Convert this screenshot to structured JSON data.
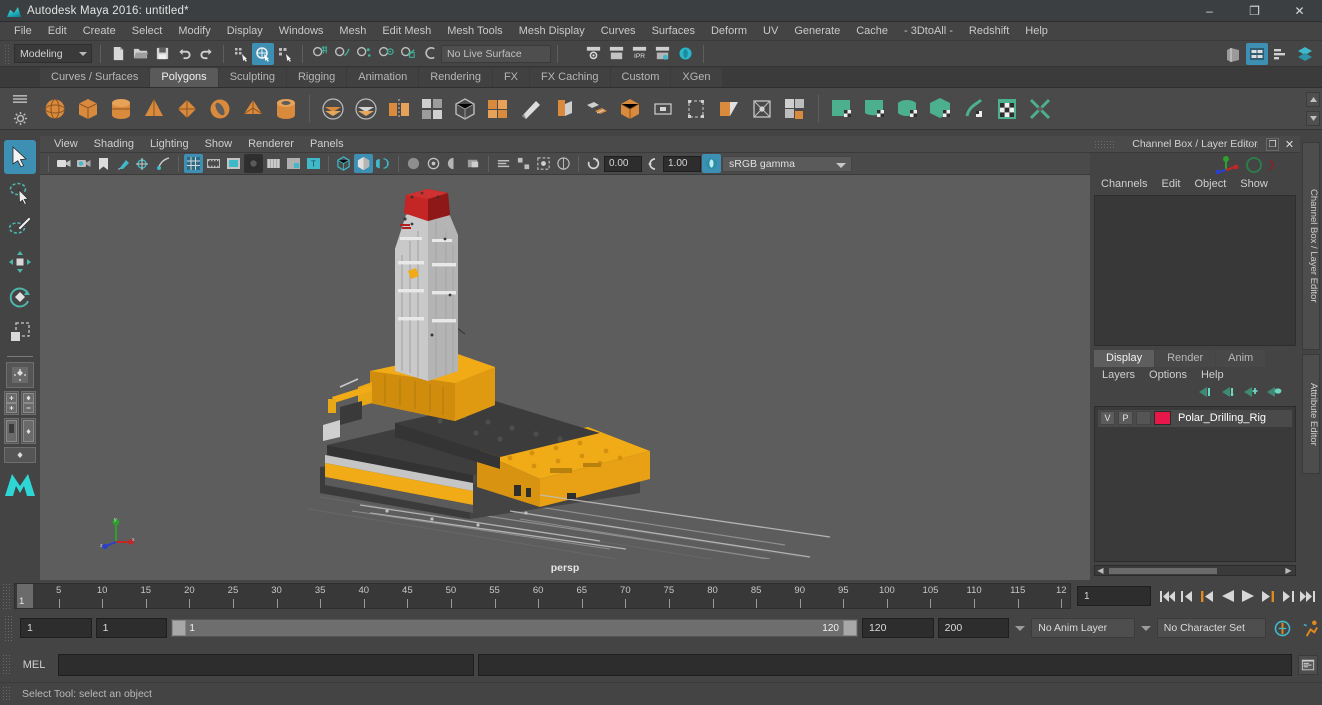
{
  "window": {
    "title": "Autodesk Maya 2016: untitled*",
    "icon": "maya-logo-icon",
    "minimize": "–",
    "maximize": "❐",
    "close": "✕"
  },
  "menubar": {
    "items": [
      {
        "label": "File"
      },
      {
        "label": "Edit"
      },
      {
        "label": "Create"
      },
      {
        "label": "Select"
      },
      {
        "label": "Modify"
      },
      {
        "label": "Display"
      },
      {
        "label": "Windows"
      },
      {
        "label": "Mesh"
      },
      {
        "label": "Edit Mesh"
      },
      {
        "label": "Mesh Tools"
      },
      {
        "label": "Mesh Display"
      },
      {
        "label": "Curves"
      },
      {
        "label": "Surfaces"
      },
      {
        "label": "Deform"
      },
      {
        "label": "UV"
      },
      {
        "label": "Generate"
      },
      {
        "label": "Cache"
      },
      {
        "label": "- 3DtoAll -"
      },
      {
        "label": "Redshift"
      },
      {
        "label": "Help"
      }
    ]
  },
  "statusline": {
    "menuset": "Modeling",
    "live_surface": "No Live Surface",
    "file_icons": [
      "new-scene-icon",
      "open-scene-icon",
      "save-scene-icon",
      "undo-icon",
      "redo-icon"
    ],
    "select_mode_icons": [
      "select-by-hierarchy-icon",
      "select-by-object-type-icon",
      "select-by-component-type-icon"
    ],
    "snap_icons": [
      "snap-to-grid-icon",
      "snap-to-curve-icon",
      "snap-to-point-icon",
      "snap-to-projected-center-icon",
      "snap-to-view-plane-icon",
      "make-live-icon"
    ],
    "render_icons": [
      "render-current-frame-icon",
      "render-sequence-icon",
      "ipr-render-icon",
      "render-settings-icon",
      "hypershade-icon"
    ],
    "panel_toggle_icons": [
      "toggle-modeling-panel-icon",
      "toggle-attribute-editor-icon",
      "toggle-tool-settings-icon",
      "toggle-channel-box-icon"
    ]
  },
  "shelf": {
    "tabs": [
      {
        "label": "Curves / Surfaces",
        "active": false
      },
      {
        "label": "Polygons",
        "active": true
      },
      {
        "label": "Sculpting",
        "active": false
      },
      {
        "label": "Rigging",
        "active": false
      },
      {
        "label": "Animation",
        "active": false
      },
      {
        "label": "Rendering",
        "active": false
      },
      {
        "label": "FX",
        "active": false
      },
      {
        "label": "FX Caching",
        "active": false
      },
      {
        "label": "Custom",
        "active": false
      },
      {
        "label": "XGen",
        "active": false
      }
    ],
    "icons": [
      "polygon-sphere-icon",
      "polygon-cube-icon",
      "polygon-cylinder-icon",
      "polygon-cone-icon",
      "polygon-plane-icon",
      "polygon-torus-icon",
      "polygon-pyramid-icon",
      "polygon-pipe-icon",
      "sep",
      "boolean-union-icon",
      "boolean-difference-icon",
      "mirror-geometry-icon",
      "combine-icon",
      "smooth-icon",
      "sep2",
      "multi-cut-icon",
      "extrude-icon",
      "bevel-icon",
      "bridge-icon",
      "append-polygon-icon",
      "wedge-face-icon",
      "poke-face-icon",
      "chamfer-vertex-icon",
      "connect-icon",
      "detach-icon",
      "sep3",
      "uv-planar-icon",
      "uv-cylindrical-icon",
      "uv-spherical-icon",
      "uv-automatic-icon",
      "uv-unfold-icon",
      "uv-editor-icon",
      "uv-cut-sew-icon"
    ]
  },
  "toolbox": {
    "tools": [
      {
        "name": "select-tool",
        "active": true
      },
      {
        "name": "lasso-select-tool",
        "active": false
      },
      {
        "name": "paint-select-tool",
        "active": false
      },
      {
        "name": "move-tool",
        "active": false
      },
      {
        "name": "rotate-tool",
        "active": false
      },
      {
        "name": "scale-tool",
        "active": false
      }
    ],
    "layouts": [
      "single-perspective-layout",
      "four-view-layout",
      "persp-outliner-layout",
      "hypershade-layout",
      "render-view-layout"
    ]
  },
  "viewport": {
    "menus": [
      "View",
      "Shading",
      "Lighting",
      "Show",
      "Renderer",
      "Panels"
    ],
    "toolbar_icons": [
      "select-camera-icon",
      "camera-attributes-icon",
      "bookmark-icon",
      "image-plane-icon",
      "two-d-pan-zoom-icon",
      "grease-pencil-icon",
      "grid-toggle-icon",
      "film-gate-icon",
      "resolution-gate-icon",
      "gate-mask-icon",
      "film-origin-icon",
      "exposure-icon",
      "texture-icon",
      "wireframe-icon",
      "smooth-shade-icon",
      "shaded-wireframe-icon",
      "textured-icon",
      "use-all-lights-icon",
      "shadows-icon",
      "screen-space-ao-icon",
      "motion-blur-icon",
      "multisample-icon",
      "isolate-select-icon",
      "xray-icon"
    ],
    "exposure_value": "0.00",
    "gamma_value": "1.00",
    "color_space": "sRGB gamma",
    "camera_label": "persp",
    "axis_labels": {
      "x": "x",
      "y": "y",
      "z": "z"
    }
  },
  "channel_box": {
    "panel_title": "Channel Box / Layer Editor",
    "menus": [
      "Channels",
      "Edit",
      "Object",
      "Show"
    ],
    "side_tabs": [
      "Channel Box / Layer Editor",
      "Attribute Editor"
    ],
    "undock_btn": "❐",
    "close_btn": "✕"
  },
  "layer_editor": {
    "tabs": [
      {
        "label": "Display",
        "active": true
      },
      {
        "label": "Render",
        "active": false
      },
      {
        "label": "Anim",
        "active": false
      }
    ],
    "menus": [
      "Layers",
      "Options",
      "Help"
    ],
    "buttons": [
      "move-layer-up-icon",
      "move-layer-down-icon",
      "new-layer-icon",
      "new-layer-from-selected-icon"
    ],
    "layers": [
      {
        "visibility": "V",
        "playback": "P",
        "state": "",
        "color": "#e8174a",
        "name": "Polar_Drilling_Rig"
      }
    ]
  },
  "timeline": {
    "current_frame": "1",
    "frame_field": "1",
    "ticks": [
      {
        "label": "5",
        "frame": 5
      },
      {
        "label": "10",
        "frame": 10
      },
      {
        "label": "15",
        "frame": 15
      },
      {
        "label": "20",
        "frame": 20
      },
      {
        "label": "25",
        "frame": 25
      },
      {
        "label": "30",
        "frame": 30
      },
      {
        "label": "35",
        "frame": 35
      },
      {
        "label": "40",
        "frame": 40
      },
      {
        "label": "45",
        "frame": 45
      },
      {
        "label": "50",
        "frame": 50
      },
      {
        "label": "55",
        "frame": 55
      },
      {
        "label": "60",
        "frame": 60
      },
      {
        "label": "65",
        "frame": 65
      },
      {
        "label": "70",
        "frame": 70
      },
      {
        "label": "75",
        "frame": 75
      },
      {
        "label": "80",
        "frame": 80
      },
      {
        "label": "85",
        "frame": 85
      },
      {
        "label": "90",
        "frame": 90
      },
      {
        "label": "95",
        "frame": 95
      },
      {
        "label": "100",
        "frame": 100
      },
      {
        "label": "105",
        "frame": 105
      },
      {
        "label": "110",
        "frame": 110
      },
      {
        "label": "115",
        "frame": 115
      },
      {
        "label": "12",
        "frame": 120
      }
    ],
    "playback_buttons": [
      "go-to-start-icon",
      "step-back-keyframe-icon",
      "step-back-frame-icon",
      "play-backwards-icon",
      "play-forwards-icon",
      "step-forward-frame-icon",
      "step-forward-keyframe-icon",
      "go-to-end-icon"
    ]
  },
  "range_slider": {
    "anim_start": "1",
    "range_start": "1",
    "bar_start_label": "1",
    "bar_end_label": "120",
    "range_end": "120",
    "anim_end": "200",
    "anim_layer": "No Anim Layer",
    "character_set": "No Character Set",
    "auto_key_icon": "auto-keyframe-icon",
    "anim_prefs_icon": "animation-preferences-icon"
  },
  "command_line": {
    "language_label": "MEL",
    "input_value": "",
    "output_value": "",
    "script_editor_icon": "script-editor-icon"
  },
  "help_line": {
    "message": "Select Tool: select an object"
  },
  "scene": {
    "object_name": "Polar_Drilling_Rig",
    "derrick_color": "#c9c9c9",
    "crown_color": "#b01e1e",
    "deck_color": "#f0ab17",
    "hull_color": "#3e3e3e",
    "background_color": "#5d5d5d"
  }
}
